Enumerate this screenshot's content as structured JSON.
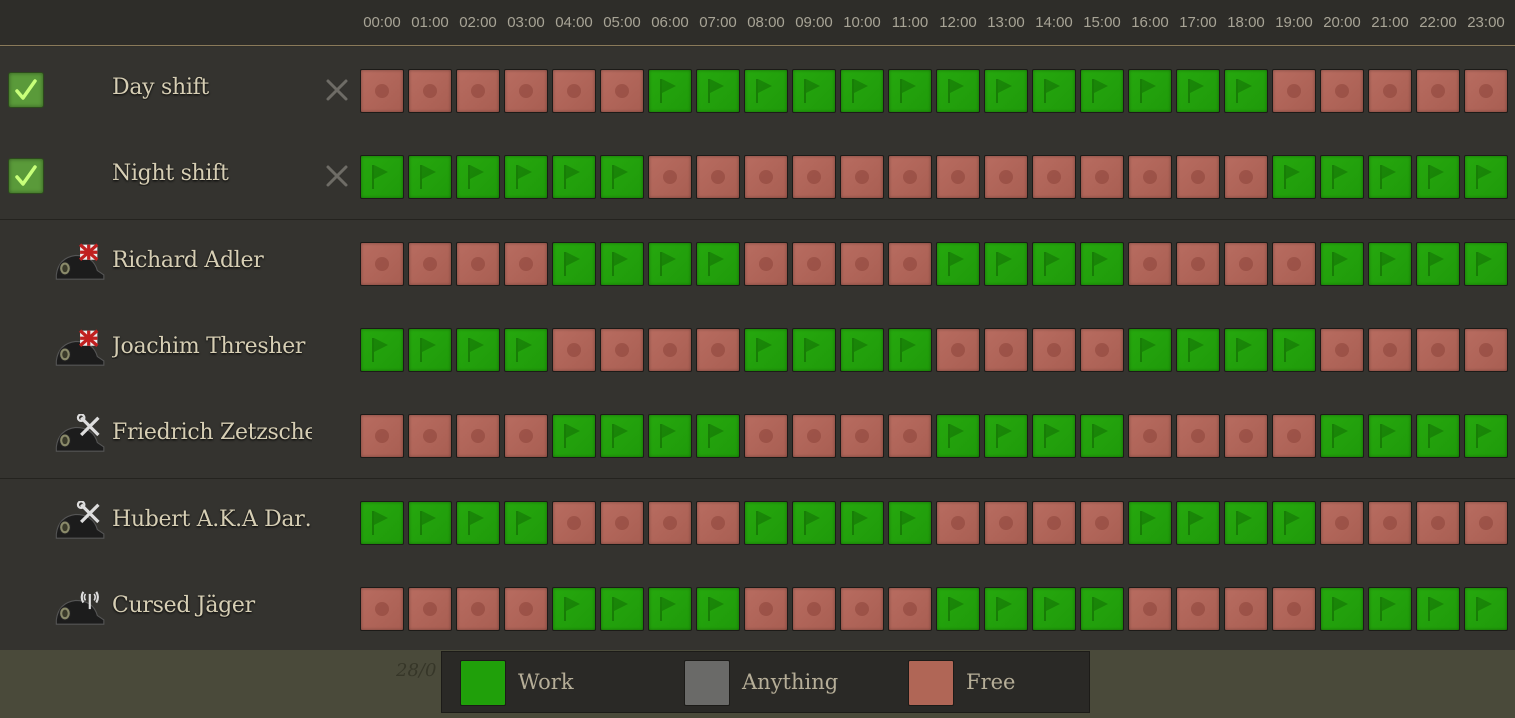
{
  "hours": [
    "00:00",
    "01:00",
    "02:00",
    "03:00",
    "04:00",
    "05:00",
    "06:00",
    "07:00",
    "08:00",
    "09:00",
    "10:00",
    "11:00",
    "12:00",
    "13:00",
    "14:00",
    "15:00",
    "16:00",
    "17:00",
    "18:00",
    "19:00",
    "20:00",
    "21:00",
    "22:00",
    "23:00"
  ],
  "colors": {
    "work": "#20a00a",
    "free": "#b06656",
    "anything": "#6a6a68",
    "check": "#5a9a3a",
    "text": "#d6ceb4"
  },
  "rows": [
    {
      "name": "Day shift",
      "kind": "template",
      "checked": true,
      "icon": "",
      "schedule": [
        "free",
        "free",
        "free",
        "free",
        "free",
        "free",
        "work",
        "work",
        "work",
        "work",
        "work",
        "work",
        "work",
        "work",
        "work",
        "work",
        "work",
        "work",
        "work",
        "free",
        "free",
        "free",
        "free",
        "free"
      ]
    },
    {
      "name": "Night shift",
      "kind": "template",
      "checked": true,
      "icon": "",
      "schedule": [
        "work",
        "work",
        "work",
        "work",
        "work",
        "work",
        "free",
        "free",
        "free",
        "free",
        "free",
        "free",
        "free",
        "free",
        "free",
        "free",
        "free",
        "free",
        "free",
        "work",
        "work",
        "work",
        "work",
        "work"
      ]
    },
    {
      "name": "Richard Adler",
      "kind": "soldier",
      "icon": "iron-cross-icon",
      "schedule": [
        "free",
        "free",
        "free",
        "free",
        "work",
        "work",
        "work",
        "work",
        "free",
        "free",
        "free",
        "free",
        "work",
        "work",
        "work",
        "work",
        "free",
        "free",
        "free",
        "free",
        "work",
        "work",
        "work",
        "work"
      ]
    },
    {
      "name": "Joachim Thresher",
      "kind": "soldier",
      "icon": "iron-cross-icon",
      "schedule": [
        "work",
        "work",
        "work",
        "work",
        "free",
        "free",
        "free",
        "free",
        "work",
        "work",
        "work",
        "work",
        "free",
        "free",
        "free",
        "free",
        "work",
        "work",
        "work",
        "work",
        "free",
        "free",
        "free",
        "free"
      ]
    },
    {
      "name": "Friedrich Zetzsche",
      "kind": "soldier",
      "icon": "wrench-icon",
      "schedule": [
        "free",
        "free",
        "free",
        "free",
        "work",
        "work",
        "work",
        "work",
        "free",
        "free",
        "free",
        "free",
        "work",
        "work",
        "work",
        "work",
        "free",
        "free",
        "free",
        "free",
        "work",
        "work",
        "work",
        "work"
      ]
    },
    {
      "name": "Hubert A.K.A Dar…",
      "kind": "soldier",
      "icon": "wrench-icon",
      "schedule": [
        "work",
        "work",
        "work",
        "work",
        "free",
        "free",
        "free",
        "free",
        "work",
        "work",
        "work",
        "work",
        "free",
        "free",
        "free",
        "free",
        "work",
        "work",
        "work",
        "work",
        "free",
        "free",
        "free",
        "free"
      ]
    },
    {
      "name": "Cursed Jäger",
      "kind": "soldier",
      "icon": "radio-icon",
      "schedule": [
        "free",
        "free",
        "free",
        "free",
        "work",
        "work",
        "work",
        "work",
        "free",
        "free",
        "free",
        "free",
        "work",
        "work",
        "work",
        "work",
        "free",
        "free",
        "free",
        "free",
        "work",
        "work",
        "work",
        "work"
      ]
    }
  ],
  "legend": [
    {
      "key": "work",
      "label": "Work"
    },
    {
      "key": "anything",
      "label": "Anything"
    },
    {
      "key": "free",
      "label": "Free"
    }
  ],
  "footer_date": "28/0"
}
